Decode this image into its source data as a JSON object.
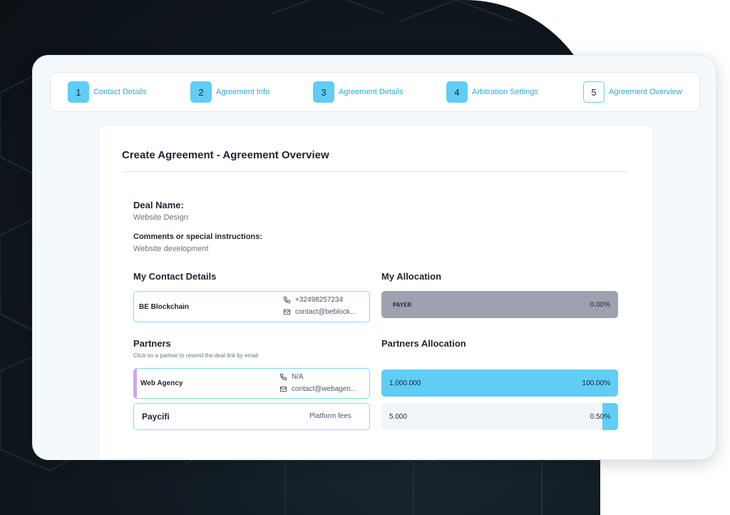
{
  "steps": [
    {
      "number": "1",
      "label": "Contact Details"
    },
    {
      "number": "2",
      "label": "Agreement Info"
    },
    {
      "number": "3",
      "label": "Agreement Details"
    },
    {
      "number": "4",
      "label": "Arbitration Settings"
    },
    {
      "number": "5",
      "label": "Agreement Overview"
    }
  ],
  "page_title": "Create Agreement - Agreement Overview",
  "deal": {
    "name_label": "Deal Name:",
    "name_value": "Website Design",
    "comments_label": "Comments or special instructions:",
    "comments_value": "Website development"
  },
  "my_contact": {
    "title": "My Contact Details",
    "name": "BE Blockchain",
    "phone": "+32498257234",
    "email": "contact@beblock..."
  },
  "my_allocation": {
    "title": "My Allocation",
    "role": "PAYER",
    "percent": "0.00%"
  },
  "partners": {
    "title": "Partners",
    "hint": "Click on a partner to resend the deal link by email",
    "items": [
      {
        "name": "Web Agency",
        "phone": "N/A",
        "email": "contact@webagen..."
      },
      {
        "name": "Paycifi",
        "note": "Platform fees"
      }
    ]
  },
  "partners_allocation": {
    "title": "Partners Allocation",
    "items": [
      {
        "amount": "1,000.000",
        "percent": "100.00%",
        "fraction": 1.0
      },
      {
        "amount": "5.000",
        "percent": "0.50%",
        "fraction": 0.005
      }
    ]
  },
  "colors": {
    "accent": "#5fcdf5",
    "payer_bar": "#9ca3af",
    "partner_highlight": "#c9a8f0"
  }
}
